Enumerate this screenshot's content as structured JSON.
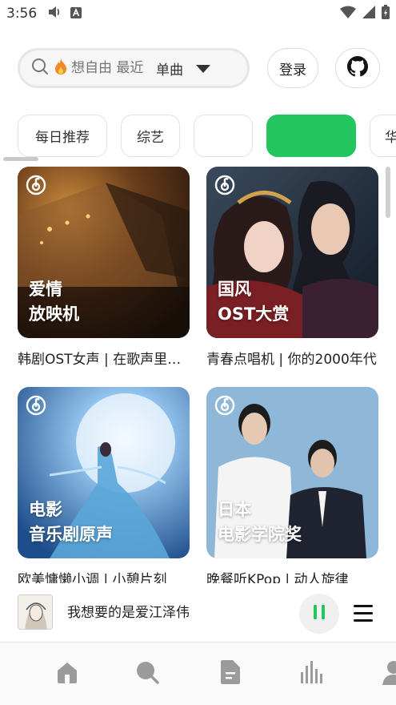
{
  "status_bar": {
    "time": "3:56"
  },
  "search": {
    "placeholder": "想自由 最近",
    "type_label": "单曲"
  },
  "header": {
    "login_label": "登录"
  },
  "categories": [
    {
      "label": "每日推荐",
      "active": false
    },
    {
      "label": "综艺",
      "active": false
    },
    {
      "label": "",
      "active": false
    },
    {
      "label": "",
      "active": true
    },
    {
      "label": "华",
      "active": false
    }
  ],
  "playlists": [
    {
      "cover_text_1": "爱情",
      "cover_text_2": "放映机",
      "title": "韩剧OST女声 | 在歌声里体会爱情"
    },
    {
      "cover_text_1": "国风",
      "cover_text_2": "OST大赏",
      "title": "青春点唱机 | 你的2000年代"
    },
    {
      "cover_text_1": "电影",
      "cover_text_2": "音乐剧原声",
      "title": "欧美慵懒小调 | 小憩片刻"
    },
    {
      "cover_text_1": "日本",
      "cover_text_2": "电影学院奖",
      "title": "晚餐听KPop | 动人旋律"
    }
  ],
  "player": {
    "title": "我想要的是爱江泽伟"
  },
  "icons": {
    "search": "search-icon",
    "fire": "fire-icon",
    "caret": "caret-down-icon",
    "github": "github-icon",
    "home": "home-icon",
    "explore": "search-icon",
    "library": "document-icon",
    "charts": "bar-chart-icon",
    "profile": "user-icon"
  },
  "colors": {
    "accent": "#22c55e",
    "nav_icon": "#9b9b9b"
  }
}
